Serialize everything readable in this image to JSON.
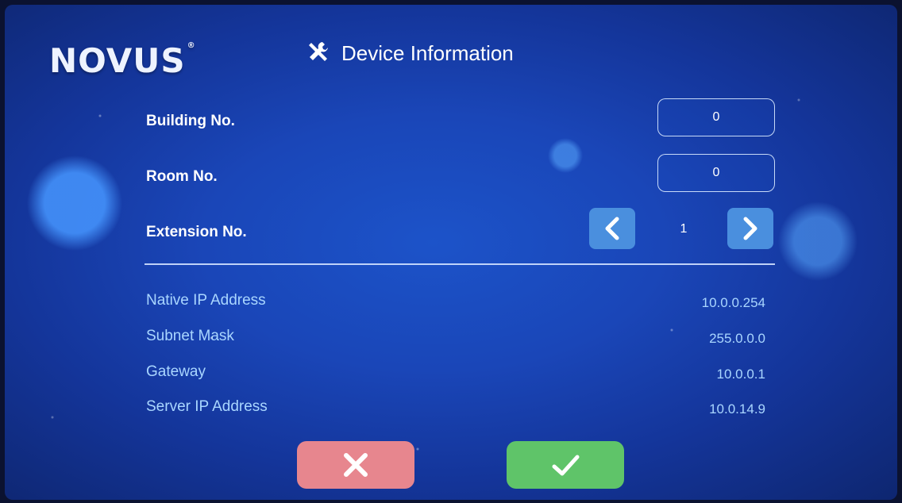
{
  "brand": {
    "logo_text": "NOVUS",
    "trademark": "®"
  },
  "header": {
    "icon": "tools-icon",
    "title": "Device Information"
  },
  "fields": {
    "building": {
      "label": "Building No.",
      "value": "0"
    },
    "room": {
      "label": "Room No.",
      "value": "0"
    },
    "extension": {
      "label": "Extension No.",
      "value": "1",
      "prev_icon": "chevron-left-icon",
      "next_icon": "chevron-right-icon"
    }
  },
  "network": [
    {
      "label": "Native IP Address",
      "value": "10.0.0.254"
    },
    {
      "label": "Subnet Mask",
      "value": "255.0.0.0"
    },
    {
      "label": "Gateway",
      "value": "10.0.0.1"
    },
    {
      "label": "Server IP Address",
      "value": "10.0.14.9"
    }
  ],
  "actions": {
    "cancel_icon": "close-icon",
    "confirm_icon": "check-icon",
    "colors": {
      "cancel": "#e7868e",
      "confirm": "#5fc469",
      "stepper": "#4a8fde",
      "info_text": "#a9d6ff"
    }
  }
}
